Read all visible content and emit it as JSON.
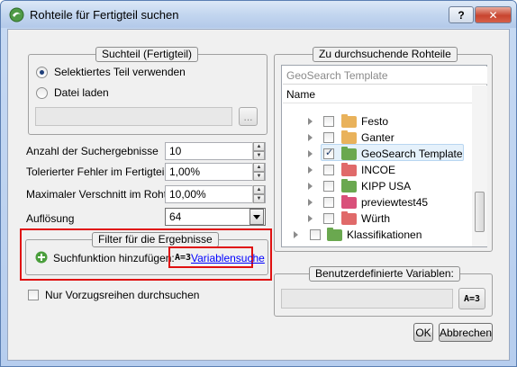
{
  "window": {
    "title": "Rohteile für Fertigteil suchen",
    "help_label": "?",
    "close_label": "✕"
  },
  "suchteil": {
    "title": "Suchteil (Fertigteil)",
    "option_selected": "Selektiertes Teil verwenden",
    "option_file": "Datei laden",
    "file_value": "",
    "browse_label": "..."
  },
  "params": {
    "count_label": "Anzahl der Suchergebnisse",
    "count_value": "10",
    "tolerance_label": "Tolerierter Fehler im Fertigteil",
    "tolerance_value": "1,00%",
    "waste_label": "Maximaler Verschnitt im Rohteil",
    "waste_value": "10,00%",
    "resolution_label": "Auflösung",
    "resolution_value": "64"
  },
  "filter": {
    "title": "Filter für die Ergebnisse",
    "add_label": "Suchfunktion hinzufügen:",
    "var_icon": "A=3",
    "var_link": "Variablensuche"
  },
  "preferred": {
    "label": "Nur Vorzugsreihen durchsuchen",
    "checked": false
  },
  "rohteile": {
    "title": "Zu durchsuchende Rohteile",
    "path_value": "GeoSearch Template",
    "column_header": "Name",
    "items": [
      {
        "label": "Festo",
        "checked": false,
        "folder_color": "#e9b25b"
      },
      {
        "label": "Ganter",
        "checked": false,
        "folder_color": "#e9b25b"
      },
      {
        "label": "GeoSearch Template",
        "checked": true,
        "folder_color": "#6aa84f"
      },
      {
        "label": "INCOE",
        "checked": false,
        "folder_color": "#e06a6a"
      },
      {
        "label": "KIPP USA",
        "checked": false,
        "folder_color": "#6aa84f"
      },
      {
        "label": "previewtest45",
        "checked": false,
        "folder_color": "#d9507a"
      },
      {
        "label": "Würth",
        "checked": false,
        "folder_color": "#e06a6a"
      },
      {
        "label": "Klassifikationen",
        "checked": false,
        "folder_color": "#6aa84f"
      }
    ]
  },
  "variablen": {
    "title": "Benutzerdefinierte Variablen:",
    "value": "",
    "btn_icon": "A=3"
  },
  "buttons": {
    "ok": "OK",
    "cancel": "Abbrechen"
  }
}
